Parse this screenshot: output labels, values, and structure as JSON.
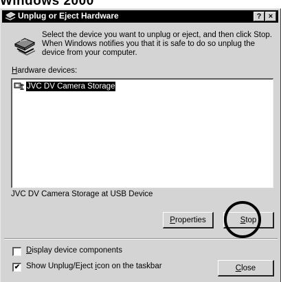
{
  "caption": "Windows 2000",
  "window": {
    "title": "Unplug or Eject Hardware",
    "help_button": "?",
    "close_button": "×"
  },
  "intro": {
    "text": "Select the device you want to unplug or eject, and then click Stop. When Windows notifies you that it is safe to do so unplug the device from your computer."
  },
  "hardware": {
    "label_prefix": "",
    "label_accel": "H",
    "label_rest": "ardware devices:",
    "devices": [
      {
        "label": "JVC DV Camera Storage",
        "selected": true
      }
    ]
  },
  "device_description": "JVC DV Camera Storage at USB Device",
  "buttons": {
    "properties_accel": "P",
    "properties_rest": "roperties",
    "stop_accel": "S",
    "stop_rest": "top",
    "close_accel": "C",
    "close_rest": "lose"
  },
  "options": {
    "display_components": {
      "accel": "D",
      "rest": "isplay device components",
      "checked": false
    },
    "show_icon": {
      "pre": "Show Unplug/Eject ",
      "accel": "i",
      "rest": "con on the taskbar",
      "checked": true,
      "check_glyph": "✔"
    }
  },
  "annotation": {
    "stop_highlight": "circled Stop button"
  }
}
